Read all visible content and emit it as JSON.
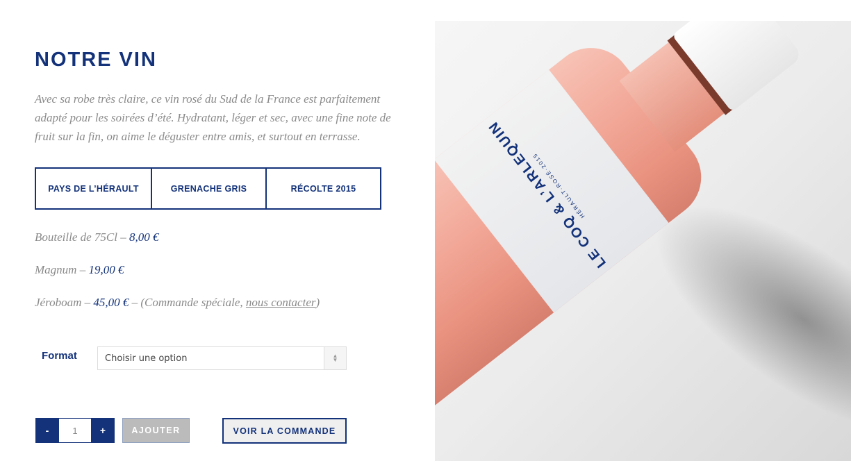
{
  "product": {
    "title": "NOTRE VIN",
    "description": "Avec sa robe très claire, ce vin rosé du Sud de la France est parfaitement adapté pour les soirées d’été. Hydratant, léger et sec, avec une fine note de fruit sur la fin, on aime le déguster entre amis, et surtout en terrasse."
  },
  "tags": [
    "PAYS DE L’HÉRAULT",
    "GRENACHE GRIS",
    "RÉCOLTE 2015"
  ],
  "prices": [
    {
      "label": "Bouteille de 75Cl –",
      "value": "8,00 €"
    },
    {
      "label": "Magnum –",
      "value": "19,00 €"
    },
    {
      "label": "Jéroboam –",
      "value": "45,00 €",
      "note_before": "– (Commande spéciale,",
      "link": "nous contacter",
      "note_after": ")"
    }
  ],
  "format": {
    "label": "Format",
    "selected": "Choisir une option"
  },
  "cart": {
    "minus": "-",
    "quantity": "1",
    "plus": "+",
    "add": "AJOUTER",
    "view": "VOIR LA COMMANDE"
  },
  "bottle_label": {
    "brand": "LE COQ & L’ARLEQUIN",
    "sub": "HÉRAULT·ROSÉ·2015"
  }
}
